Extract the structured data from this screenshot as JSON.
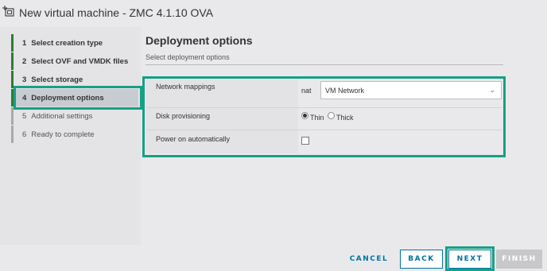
{
  "window": {
    "title": "New virtual machine - ZMC 4.1.10 OVA",
    "icon": "new-vm-icon"
  },
  "wizard": {
    "steps": [
      {
        "num": "1",
        "label": "Select creation type",
        "state": "done"
      },
      {
        "num": "2",
        "label": "Select OVF and VMDK files",
        "state": "done"
      },
      {
        "num": "3",
        "label": "Select storage",
        "state": "done"
      },
      {
        "num": "4",
        "label": "Deployment options",
        "state": "active"
      },
      {
        "num": "5",
        "label": "Additional settings",
        "state": "future"
      },
      {
        "num": "6",
        "label": "Ready to complete",
        "state": "future"
      }
    ]
  },
  "content": {
    "title": "Deployment options",
    "subtitle": "Select deployment options",
    "network_mappings": {
      "label": "Network mappings",
      "source": "nat",
      "value": "VM Network"
    },
    "disk_provisioning": {
      "label": "Disk provisioning",
      "options": [
        "Thin",
        "Thick"
      ],
      "selected": "Thin"
    },
    "power_on": {
      "label": "Power on automatically",
      "checked": false
    }
  },
  "footer": {
    "cancel": "CANCEL",
    "back": "BACK",
    "next": "NEXT",
    "finish": "FINISH"
  },
  "colors": {
    "accent": "#0072a3",
    "highlight": "#16a085",
    "step_done": "#2e7d32"
  }
}
